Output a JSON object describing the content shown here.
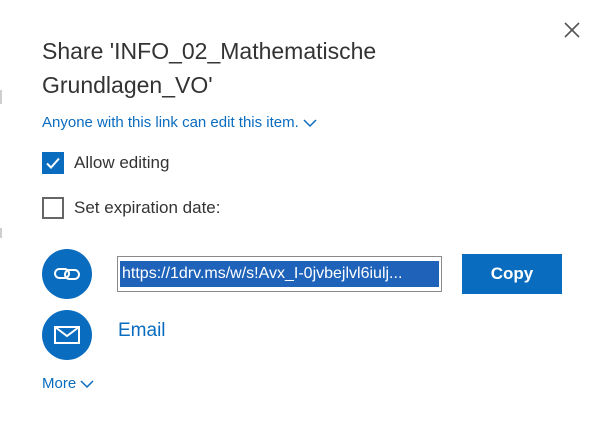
{
  "dialog": {
    "title": "Share 'INFO_02_Mathematische Grundlagen_VO'",
    "permission_link": "Anyone with this link can edit this item.",
    "allow_editing_label": "Allow editing",
    "allow_editing_checked": true,
    "expiration_label": "Set expiration date:",
    "expiration_checked": false,
    "share_link": "https://1drv.ms/w/s!Avx_I-0jvbejlvl6iulj...",
    "copy_label": "Copy",
    "email_label": "Email",
    "more_label": "More"
  },
  "icons": {
    "close": "close-icon",
    "permission_chevron": "chevron-down-icon",
    "checkmark": "checkmark-icon",
    "link": "link-icon",
    "email": "envelope-icon",
    "more_chevron": "chevron-down-icon"
  },
  "colors": {
    "accent": "#0a6cbf",
    "title_text": "#333333",
    "selection": "#1e63b9"
  }
}
